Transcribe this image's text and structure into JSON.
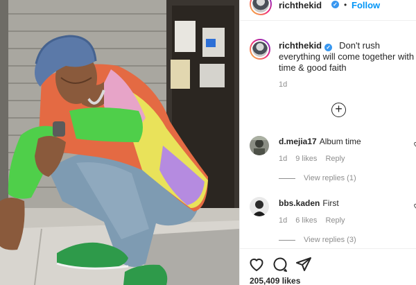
{
  "post": {
    "image_alt": "Man in bucket hat and floral hoodie crouching on sidewalk",
    "username": "richthekid",
    "follow_label": "Follow",
    "separator": "•",
    "caption": "Don't rush everything will come together with time & good faith",
    "caption_age": "1d",
    "likes": "205,409 likes"
  },
  "comments": [
    {
      "username": "d.mejia17",
      "text": "Album time",
      "age": "1d",
      "likes": "9 likes",
      "reply_label": "Reply",
      "view_replies": "View replies (1)"
    },
    {
      "username": "bbs.kaden",
      "text": "First",
      "age": "1d",
      "likes": "6 likes",
      "reply_label": "Reply",
      "view_replies": "View replies (3)"
    }
  ],
  "icons": {
    "add_comment": "plus-circle-icon",
    "like": "heart-icon",
    "comment": "speech-bubble-icon",
    "share": "paper-plane-icon",
    "verified": "verified-badge-icon"
  },
  "colors": {
    "accent": "#0095f6",
    "verified": "#3897f0",
    "muted": "#8e8e8e",
    "text": "#262626"
  }
}
